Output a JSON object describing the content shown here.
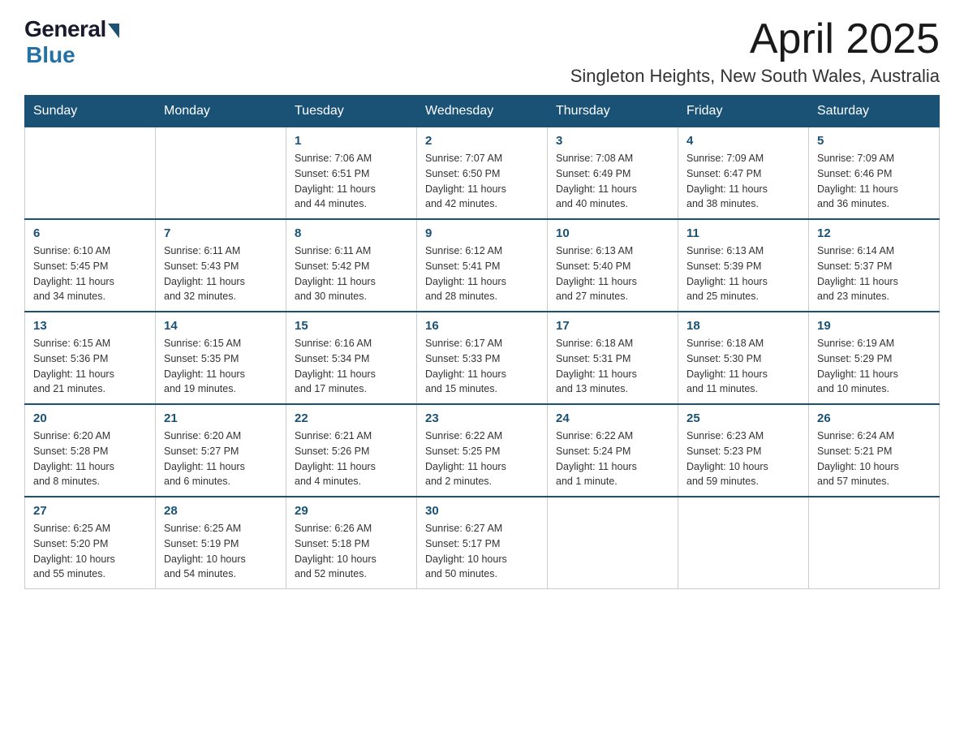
{
  "header": {
    "logo_general": "General",
    "logo_blue": "Blue",
    "month_title": "April 2025",
    "location": "Singleton Heights, New South Wales, Australia"
  },
  "weekdays": [
    "Sunday",
    "Monday",
    "Tuesday",
    "Wednesday",
    "Thursday",
    "Friday",
    "Saturday"
  ],
  "weeks": [
    [
      {
        "day": "",
        "info": ""
      },
      {
        "day": "",
        "info": ""
      },
      {
        "day": "1",
        "info": "Sunrise: 7:06 AM\nSunset: 6:51 PM\nDaylight: 11 hours\nand 44 minutes."
      },
      {
        "day": "2",
        "info": "Sunrise: 7:07 AM\nSunset: 6:50 PM\nDaylight: 11 hours\nand 42 minutes."
      },
      {
        "day": "3",
        "info": "Sunrise: 7:08 AM\nSunset: 6:49 PM\nDaylight: 11 hours\nand 40 minutes."
      },
      {
        "day": "4",
        "info": "Sunrise: 7:09 AM\nSunset: 6:47 PM\nDaylight: 11 hours\nand 38 minutes."
      },
      {
        "day": "5",
        "info": "Sunrise: 7:09 AM\nSunset: 6:46 PM\nDaylight: 11 hours\nand 36 minutes."
      }
    ],
    [
      {
        "day": "6",
        "info": "Sunrise: 6:10 AM\nSunset: 5:45 PM\nDaylight: 11 hours\nand 34 minutes."
      },
      {
        "day": "7",
        "info": "Sunrise: 6:11 AM\nSunset: 5:43 PM\nDaylight: 11 hours\nand 32 minutes."
      },
      {
        "day": "8",
        "info": "Sunrise: 6:11 AM\nSunset: 5:42 PM\nDaylight: 11 hours\nand 30 minutes."
      },
      {
        "day": "9",
        "info": "Sunrise: 6:12 AM\nSunset: 5:41 PM\nDaylight: 11 hours\nand 28 minutes."
      },
      {
        "day": "10",
        "info": "Sunrise: 6:13 AM\nSunset: 5:40 PM\nDaylight: 11 hours\nand 27 minutes."
      },
      {
        "day": "11",
        "info": "Sunrise: 6:13 AM\nSunset: 5:39 PM\nDaylight: 11 hours\nand 25 minutes."
      },
      {
        "day": "12",
        "info": "Sunrise: 6:14 AM\nSunset: 5:37 PM\nDaylight: 11 hours\nand 23 minutes."
      }
    ],
    [
      {
        "day": "13",
        "info": "Sunrise: 6:15 AM\nSunset: 5:36 PM\nDaylight: 11 hours\nand 21 minutes."
      },
      {
        "day": "14",
        "info": "Sunrise: 6:15 AM\nSunset: 5:35 PM\nDaylight: 11 hours\nand 19 minutes."
      },
      {
        "day": "15",
        "info": "Sunrise: 6:16 AM\nSunset: 5:34 PM\nDaylight: 11 hours\nand 17 minutes."
      },
      {
        "day": "16",
        "info": "Sunrise: 6:17 AM\nSunset: 5:33 PM\nDaylight: 11 hours\nand 15 minutes."
      },
      {
        "day": "17",
        "info": "Sunrise: 6:18 AM\nSunset: 5:31 PM\nDaylight: 11 hours\nand 13 minutes."
      },
      {
        "day": "18",
        "info": "Sunrise: 6:18 AM\nSunset: 5:30 PM\nDaylight: 11 hours\nand 11 minutes."
      },
      {
        "day": "19",
        "info": "Sunrise: 6:19 AM\nSunset: 5:29 PM\nDaylight: 11 hours\nand 10 minutes."
      }
    ],
    [
      {
        "day": "20",
        "info": "Sunrise: 6:20 AM\nSunset: 5:28 PM\nDaylight: 11 hours\nand 8 minutes."
      },
      {
        "day": "21",
        "info": "Sunrise: 6:20 AM\nSunset: 5:27 PM\nDaylight: 11 hours\nand 6 minutes."
      },
      {
        "day": "22",
        "info": "Sunrise: 6:21 AM\nSunset: 5:26 PM\nDaylight: 11 hours\nand 4 minutes."
      },
      {
        "day": "23",
        "info": "Sunrise: 6:22 AM\nSunset: 5:25 PM\nDaylight: 11 hours\nand 2 minutes."
      },
      {
        "day": "24",
        "info": "Sunrise: 6:22 AM\nSunset: 5:24 PM\nDaylight: 11 hours\nand 1 minute."
      },
      {
        "day": "25",
        "info": "Sunrise: 6:23 AM\nSunset: 5:23 PM\nDaylight: 10 hours\nand 59 minutes."
      },
      {
        "day": "26",
        "info": "Sunrise: 6:24 AM\nSunset: 5:21 PM\nDaylight: 10 hours\nand 57 minutes."
      }
    ],
    [
      {
        "day": "27",
        "info": "Sunrise: 6:25 AM\nSunset: 5:20 PM\nDaylight: 10 hours\nand 55 minutes."
      },
      {
        "day": "28",
        "info": "Sunrise: 6:25 AM\nSunset: 5:19 PM\nDaylight: 10 hours\nand 54 minutes."
      },
      {
        "day": "29",
        "info": "Sunrise: 6:26 AM\nSunset: 5:18 PM\nDaylight: 10 hours\nand 52 minutes."
      },
      {
        "day": "30",
        "info": "Sunrise: 6:27 AM\nSunset: 5:17 PM\nDaylight: 10 hours\nand 50 minutes."
      },
      {
        "day": "",
        "info": ""
      },
      {
        "day": "",
        "info": ""
      },
      {
        "day": "",
        "info": ""
      }
    ]
  ]
}
